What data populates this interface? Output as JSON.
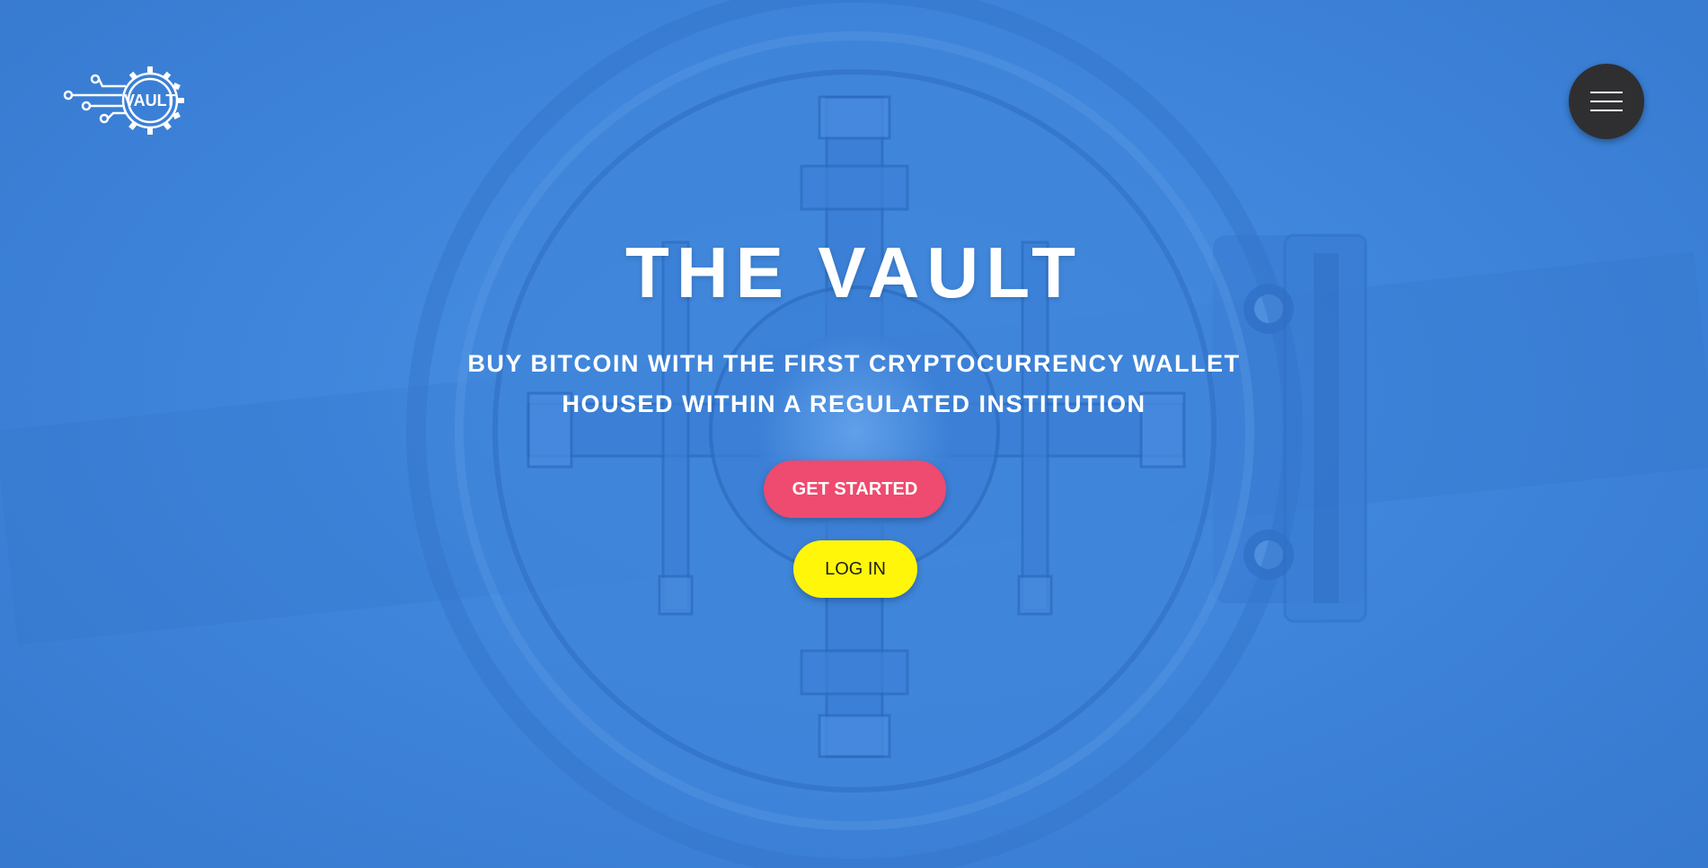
{
  "brand": {
    "logo_text": "VAULT"
  },
  "hero": {
    "title": "THE VAULT",
    "subtitle_line1": "BUY BITCOIN WITH THE FIRST CRYPTOCURRENCY WALLET",
    "subtitle_line2": "HOUSED WITHIN A REGULATED INSTITUTION"
  },
  "buttons": {
    "get_started": "GET STARTED",
    "log_in": "LOG IN"
  },
  "icons": {
    "menu": "hamburger-menu-icon",
    "logo": "gear-circuit-logo-icon"
  },
  "colors": {
    "background": "#3f86dc",
    "primary_button": "#ef4a6f",
    "secondary_button": "#fff60a",
    "menu_button": "#2f2f31",
    "text": "#ffffff"
  }
}
